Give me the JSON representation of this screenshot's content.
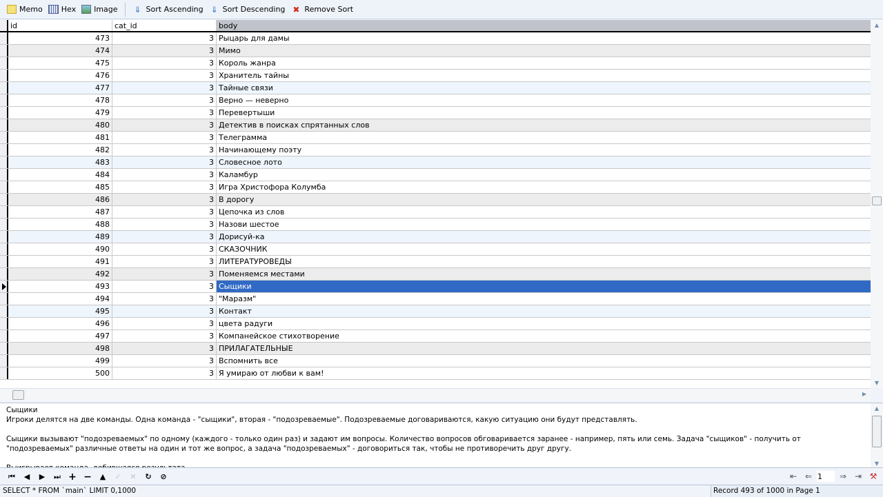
{
  "toolbar": {
    "memo": "Memo",
    "hex": "Hex",
    "image": "Image",
    "sort_asc": "Sort Ascending",
    "sort_desc": "Sort Descending",
    "remove_sort": "Remove Sort"
  },
  "grid": {
    "columns": [
      "id",
      "cat_id",
      "body"
    ],
    "selected_id": 493,
    "rows": [
      {
        "id": "473",
        "cat_id": "3",
        "body": "Рыцарь для дамы"
      },
      {
        "id": "474",
        "cat_id": "3",
        "body": "Мимо"
      },
      {
        "id": "475",
        "cat_id": "3",
        "body": "Король  жанра"
      },
      {
        "id": "476",
        "cat_id": "3",
        "body": "Хранитель тайны"
      },
      {
        "id": "477",
        "cat_id": "3",
        "body": "Тайные связи"
      },
      {
        "id": "478",
        "cat_id": "3",
        "body": "Верно — неверно"
      },
      {
        "id": "479",
        "cat_id": "3",
        "body": "Перевертыши"
      },
      {
        "id": "480",
        "cat_id": "3",
        "body": "Детектив в поисках спрятанных слов"
      },
      {
        "id": "481",
        "cat_id": "3",
        "body": "Телеграмма"
      },
      {
        "id": "482",
        "cat_id": "3",
        "body": "Начинающему поэту"
      },
      {
        "id": "483",
        "cat_id": "3",
        "body": "Словесное лото"
      },
      {
        "id": "484",
        "cat_id": "3",
        "body": "Каламбур"
      },
      {
        "id": "485",
        "cat_id": "3",
        "body": "Игра Христофора Колумба"
      },
      {
        "id": "486",
        "cat_id": "3",
        "body": "В дорогу"
      },
      {
        "id": "487",
        "cat_id": "3",
        "body": "Цепочка из слов"
      },
      {
        "id": "488",
        "cat_id": "3",
        "body": "Назови шестое"
      },
      {
        "id": "489",
        "cat_id": "3",
        "body": "Дорисуй-ка"
      },
      {
        "id": "490",
        "cat_id": "3",
        "body": "СКАЗОЧНИК"
      },
      {
        "id": "491",
        "cat_id": "3",
        "body": "ЛИТЕРАТУРОВЕДЫ"
      },
      {
        "id": "492",
        "cat_id": "3",
        "body": "Поменяемся местами"
      },
      {
        "id": "493",
        "cat_id": "3",
        "body": "Сыщики"
      },
      {
        "id": "494",
        "cat_id": "3",
        "body": "\"Маразм\""
      },
      {
        "id": "495",
        "cat_id": "3",
        "body": "Контакт"
      },
      {
        "id": "496",
        "cat_id": "3",
        "body": "цвета радуги"
      },
      {
        "id": "497",
        "cat_id": "3",
        "body": "Компанейское стихотворение"
      },
      {
        "id": "498",
        "cat_id": "3",
        "body": "ПРИЛАГАТЕЛЬНЫЕ"
      },
      {
        "id": "499",
        "cat_id": "3",
        "body": "Вспомнить все"
      },
      {
        "id": "500",
        "cat_id": "3",
        "body": "Я умираю от любви к вам!"
      }
    ]
  },
  "memo": {
    "text": "Сыщики\nИгроки делятся на две команды. Одна команда - \"сыщики\", вторая - \"подозреваемые\". Подозреваемые договариваются, какую ситуацию они будут представлять.\n\nСыщики вызывают \"подозреваемых\" по одному (каждого - только один раз) и задают им вопросы. Количество вопросов обговаривается заранее - например, пять или семь. Задача \"сыщиков\" - получить от \"подозреваемых\" различные ответы на один и тот же вопрос, а задача \"подозреваемых\" - договориться так, чтобы не противоречить друг другу.\n\nВыигрывает команда, добившаяся результата."
  },
  "pager": {
    "page": "1"
  },
  "status": {
    "sql": "SELECT * FROM `main` LIMIT 0,1000",
    "record": "Record 493 of 1000 in Page 1"
  },
  "colors": {
    "selection": "#316ac5",
    "row_grey": "#ececec",
    "row_blue": "#eef5fd"
  }
}
